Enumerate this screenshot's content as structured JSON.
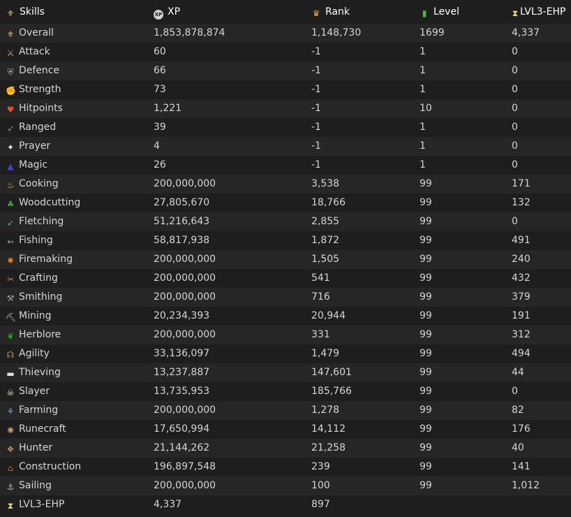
{
  "header": {
    "skills_label": "Skills",
    "xp_label": "XP",
    "rank_label": "Rank",
    "level_label": "Level",
    "ehp_label": "LVL3-EHP",
    "xp_badge": "XP"
  },
  "rows": [
    {
      "skill": "Overall",
      "xp": "1,853,878,874",
      "rank": "1,148,730",
      "level": "1699",
      "ehp": "4,337",
      "icon": "overall-icon",
      "glyph": "⚜",
      "color": "#d8c27a"
    },
    {
      "skill": "Attack",
      "xp": "60",
      "rank": "-1",
      "level": "1",
      "ehp": "0",
      "icon": "attack-icon",
      "glyph": "⚔",
      "color": "#c9b27a"
    },
    {
      "skill": "Defence",
      "xp": "66",
      "rank": "-1",
      "level": "1",
      "ehp": "0",
      "icon": "defence-icon",
      "glyph": "⛨",
      "color": "#b8b8b8"
    },
    {
      "skill": "Strength",
      "xp": "73",
      "rank": "-1",
      "level": "1",
      "ehp": "0",
      "icon": "strength-icon",
      "glyph": "✊",
      "color": "#d9b48a"
    },
    {
      "skill": "Hitpoints",
      "xp": "1,221",
      "rank": "-1",
      "level": "10",
      "ehp": "0",
      "icon": "hitpoints-icon",
      "glyph": "♥",
      "color": "#e0532a"
    },
    {
      "skill": "Ranged",
      "xp": "39",
      "rank": "-1",
      "level": "1",
      "ehp": "0",
      "icon": "ranged-icon",
      "glyph": "➶",
      "color": "#a08a5a"
    },
    {
      "skill": "Prayer",
      "xp": "4",
      "rank": "-1",
      "level": "1",
      "ehp": "0",
      "icon": "prayer-icon",
      "glyph": "✦",
      "color": "#e8f0d8"
    },
    {
      "skill": "Magic",
      "xp": "26",
      "rank": "-1",
      "level": "1",
      "ehp": "0",
      "icon": "magic-icon",
      "glyph": "▲",
      "color": "#3a48c8"
    },
    {
      "skill": "Cooking",
      "xp": "200,000,000",
      "rank": "3,538",
      "level": "99",
      "ehp": "171",
      "icon": "cooking-icon",
      "glyph": "♨",
      "color": "#d4c070"
    },
    {
      "skill": "Woodcutting",
      "xp": "27,805,670",
      "rank": "18,766",
      "level": "99",
      "ehp": "132",
      "icon": "woodcutting-icon",
      "glyph": "♣",
      "color": "#3e9a3a"
    },
    {
      "skill": "Fletching",
      "xp": "51,216,643",
      "rank": "2,855",
      "level": "99",
      "ehp": "0",
      "icon": "fletching-icon",
      "glyph": "➹",
      "color": "#4aa050"
    },
    {
      "skill": "Fishing",
      "xp": "58,817,938",
      "rank": "1,872",
      "level": "99",
      "ehp": "491",
      "icon": "fishing-icon",
      "glyph": "➳",
      "color": "#9ab0c0"
    },
    {
      "skill": "Firemaking",
      "xp": "200,000,000",
      "rank": "1,505",
      "level": "99",
      "ehp": "240",
      "icon": "firemaking-icon",
      "glyph": "✹",
      "color": "#e07a20"
    },
    {
      "skill": "Crafting",
      "xp": "200,000,000",
      "rank": "541",
      "level": "99",
      "ehp": "432",
      "icon": "crafting-icon",
      "glyph": "✂",
      "color": "#b08050"
    },
    {
      "skill": "Smithing",
      "xp": "200,000,000",
      "rank": "716",
      "level": "99",
      "ehp": "379",
      "icon": "smithing-icon",
      "glyph": "⚒",
      "color": "#a0a0a0"
    },
    {
      "skill": "Mining",
      "xp": "20,234,393",
      "rank": "20,944",
      "level": "99",
      "ehp": "191",
      "icon": "mining-icon",
      "glyph": "⛏",
      "color": "#c0c0c0"
    },
    {
      "skill": "Herblore",
      "xp": "200,000,000",
      "rank": "331",
      "level": "99",
      "ehp": "312",
      "icon": "herblore-icon",
      "glyph": "❦",
      "color": "#30a030"
    },
    {
      "skill": "Agility",
      "xp": "33,136,097",
      "rank": "1,479",
      "level": "99",
      "ehp": "494",
      "icon": "agility-icon",
      "glyph": "☊",
      "color": "#c09060"
    },
    {
      "skill": "Thieving",
      "xp": "13,237,887",
      "rank": "147,601",
      "level": "99",
      "ehp": "44",
      "icon": "thieving-icon",
      "glyph": "▬",
      "color": "#e0e0e0"
    },
    {
      "skill": "Slayer",
      "xp": "13,735,953",
      "rank": "185,766",
      "level": "99",
      "ehp": "0",
      "icon": "slayer-icon",
      "glyph": "☠",
      "color": "#e0d8c8"
    },
    {
      "skill": "Farming",
      "xp": "200,000,000",
      "rank": "1,278",
      "level": "99",
      "ehp": "82",
      "icon": "farming-icon",
      "glyph": "⚘",
      "color": "#8a9ad0"
    },
    {
      "skill": "Runecraft",
      "xp": "17,650,994",
      "rank": "14,112",
      "level": "99",
      "ehp": "176",
      "icon": "runecraft-icon",
      "glyph": "✺",
      "color": "#c0a080"
    },
    {
      "skill": "Hunter",
      "xp": "21,144,262",
      "rank": "21,258",
      "level": "99",
      "ehp": "40",
      "icon": "hunter-icon",
      "glyph": "❖",
      "color": "#b09070"
    },
    {
      "skill": "Construction",
      "xp": "196,897,548",
      "rank": "239",
      "level": "99",
      "ehp": "141",
      "icon": "construction-icon",
      "glyph": "⌂",
      "color": "#e05050"
    },
    {
      "skill": "Sailing",
      "xp": "200,000,000",
      "rank": "100",
      "level": "99",
      "ehp": "1,012",
      "icon": "sailing-icon",
      "glyph": "⚓",
      "color": "#c0c0c0"
    },
    {
      "skill": "LVL3-EHP",
      "xp": "4,337",
      "rank": "897",
      "level": "",
      "ehp": "",
      "icon": "hourglass-icon",
      "glyph": "⧗",
      "color": "#e8e070"
    }
  ]
}
